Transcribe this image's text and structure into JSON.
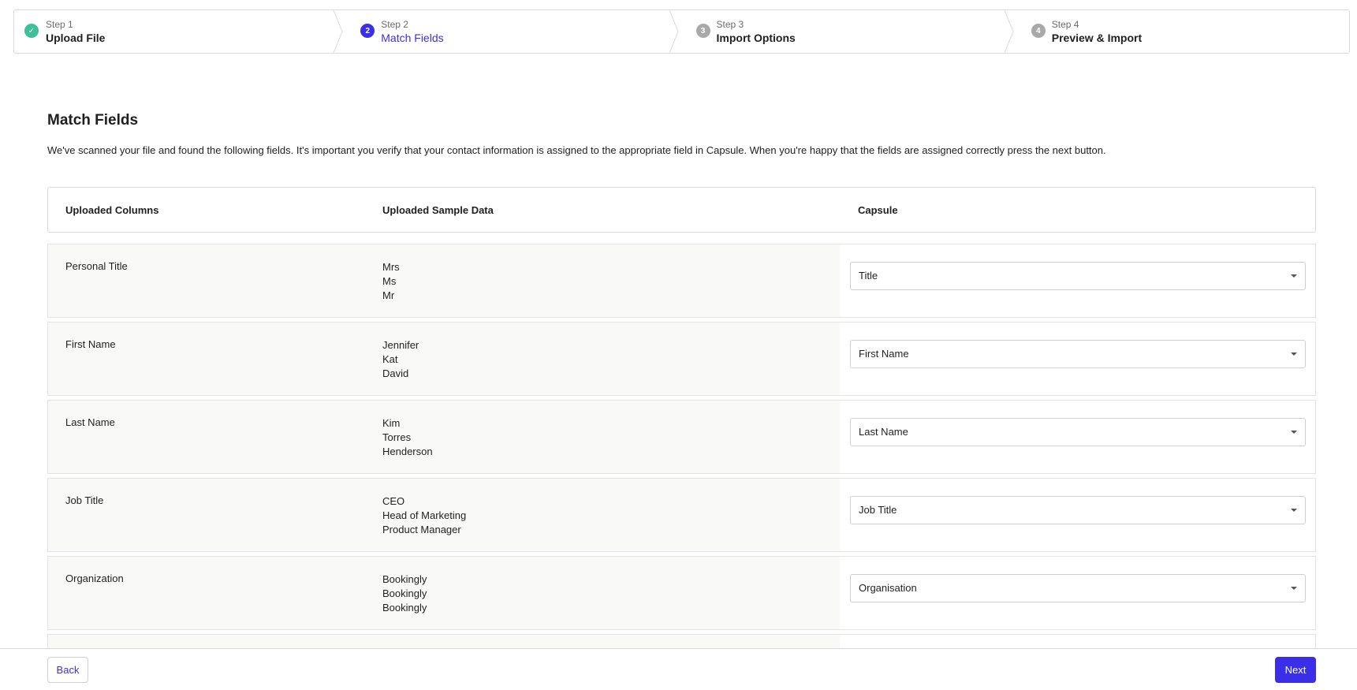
{
  "stepper": {
    "steps": [
      {
        "num": "Step 1",
        "label": "Upload File",
        "state": "done",
        "badge": "✓"
      },
      {
        "num": "Step 2",
        "label": "Match Fields",
        "state": "active",
        "badge": "2"
      },
      {
        "num": "Step 3",
        "label": "Import Options",
        "state": "pending",
        "badge": "3"
      },
      {
        "num": "Step 4",
        "label": "Preview & Import",
        "state": "pending",
        "badge": "4"
      }
    ]
  },
  "main": {
    "title": "Match Fields",
    "intro": "We've scanned your file and found the following fields. It's important you verify that your contact information is assigned to the appropriate field in Capsule. When you're happy that the fields are assigned correctly press the next button.",
    "headers": {
      "uploaded_columns": "Uploaded Columns",
      "sample_data": "Uploaded Sample Data",
      "capsule": "Capsule"
    },
    "rows": [
      {
        "column": "Personal Title",
        "samples": [
          "Mrs",
          "Ms",
          "Mr"
        ],
        "mapped": "Title"
      },
      {
        "column": "First Name",
        "samples": [
          "Jennifer",
          "Kat",
          "David"
        ],
        "mapped": "First Name"
      },
      {
        "column": "Last Name",
        "samples": [
          "Kim",
          "Torres",
          "Henderson"
        ],
        "mapped": "Last Name"
      },
      {
        "column": "Job Title",
        "samples": [
          "CEO",
          "Head of Marketing",
          "Product Manager"
        ],
        "mapped": "Job Title"
      },
      {
        "column": "Organization",
        "samples": [
          "Bookingly",
          "Bookingly",
          "Bookingly"
        ],
        "mapped": "Organisation"
      }
    ]
  },
  "footer": {
    "back_label": "Back",
    "next_label": "Next"
  },
  "colors": {
    "accent": "#3a2ee8",
    "done": "#3fbf9b",
    "pending": "#a9a9a9"
  }
}
